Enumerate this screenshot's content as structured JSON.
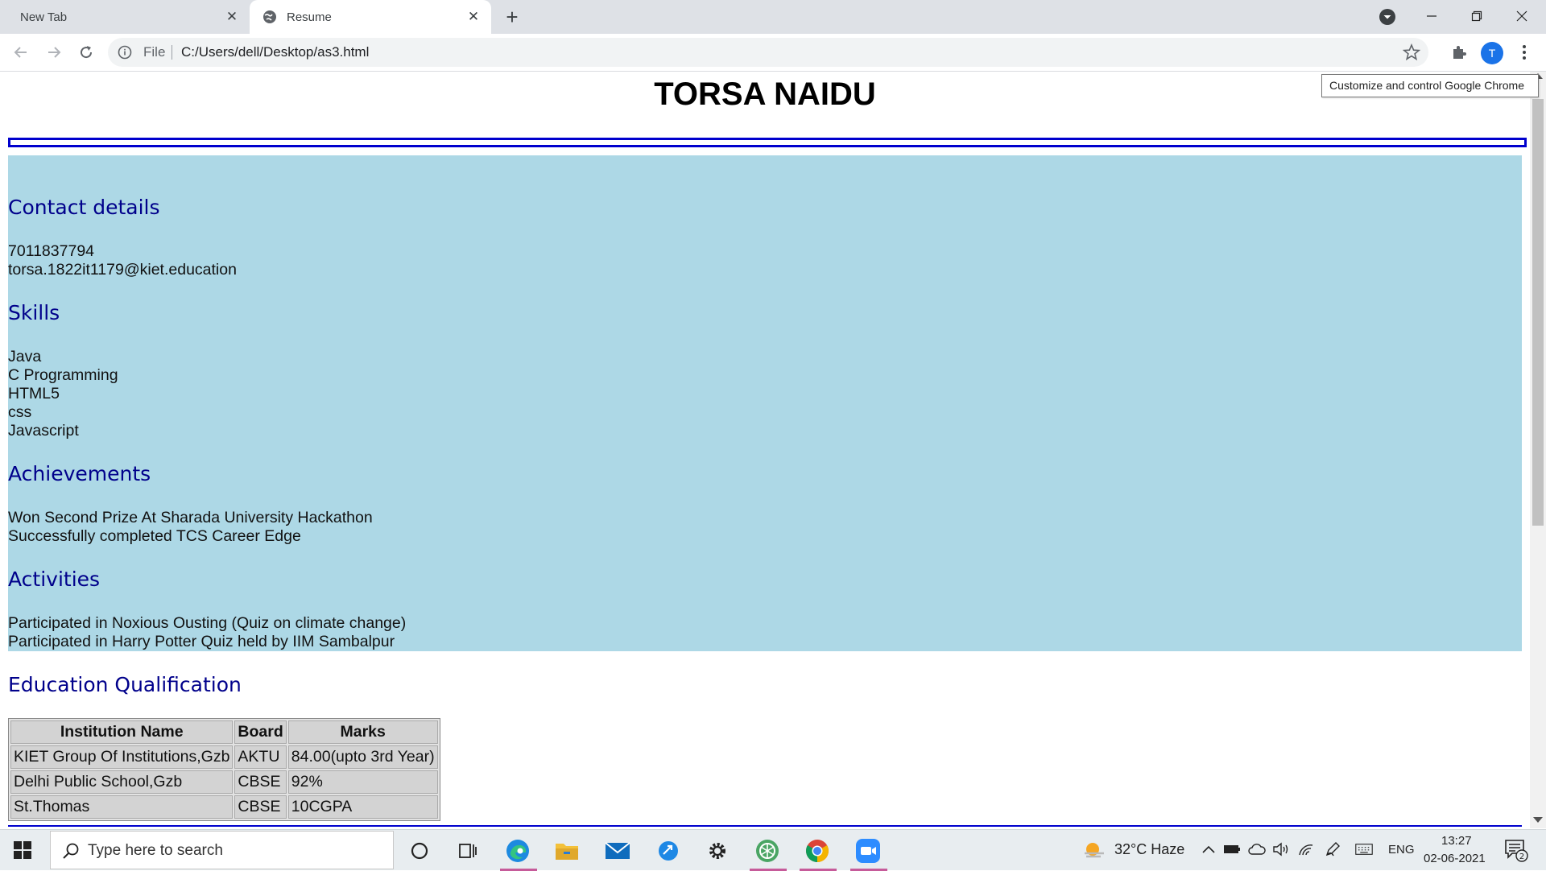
{
  "browser": {
    "tabs": [
      {
        "label": "New Tab",
        "active": false
      },
      {
        "label": "Resume",
        "active": true
      }
    ],
    "omnibox": {
      "scheme_label": "File",
      "url": "C:/Users/dell/Desktop/as3.html"
    },
    "profile_initial": "T",
    "tooltip": "Customize and control Google Chrome"
  },
  "page": {
    "title": "TORSA NAIDU",
    "panel_color": "#add8e6",
    "heading_color": "#00008b",
    "rule_color": "#0000cd",
    "sections": {
      "contact": {
        "heading": "Contact details",
        "lines": [
          "7011837794",
          "torsa.1822it1179@kiet.education"
        ]
      },
      "skills": {
        "heading": "Skills",
        "lines": [
          "Java",
          "C Programming",
          "HTML5",
          "css",
          "Javascript"
        ]
      },
      "achievements": {
        "heading": "Achievements",
        "lines": [
          "Won Second Prize At Sharada University Hackathon",
          "Successfully completed TCS Career Edge"
        ]
      },
      "activities": {
        "heading": "Activities",
        "lines": [
          "Participated in Noxious Ousting (Quiz on climate change)",
          "Participated in Harry Potter Quiz held by IIM Sambalpur"
        ]
      },
      "education": {
        "heading": "Education Qualification",
        "columns": [
          "Institution Name",
          "Board",
          "Marks"
        ],
        "rows": [
          [
            "KIET Group Of Institutions,Gzb",
            "AKTU",
            "84.00(upto 3rd Year)"
          ],
          [
            "Delhi Public School,Gzb",
            "CBSE",
            "92%"
          ],
          [
            "St.Thomas",
            "CBSE",
            "10CGPA"
          ]
        ]
      }
    }
  },
  "taskbar": {
    "search_placeholder": "Type here to search",
    "apps": [
      "task-view-icon",
      "edge-icon",
      "file-explorer-icon",
      "mail-icon",
      "app-icon",
      "settings-icon",
      "chrome-canary-icon",
      "chrome-icon",
      "zoom-icon"
    ],
    "weather": "32°C  Haze",
    "language": "ENG",
    "time": "13:27",
    "date": "02-06-2021",
    "notification_count": "2"
  }
}
